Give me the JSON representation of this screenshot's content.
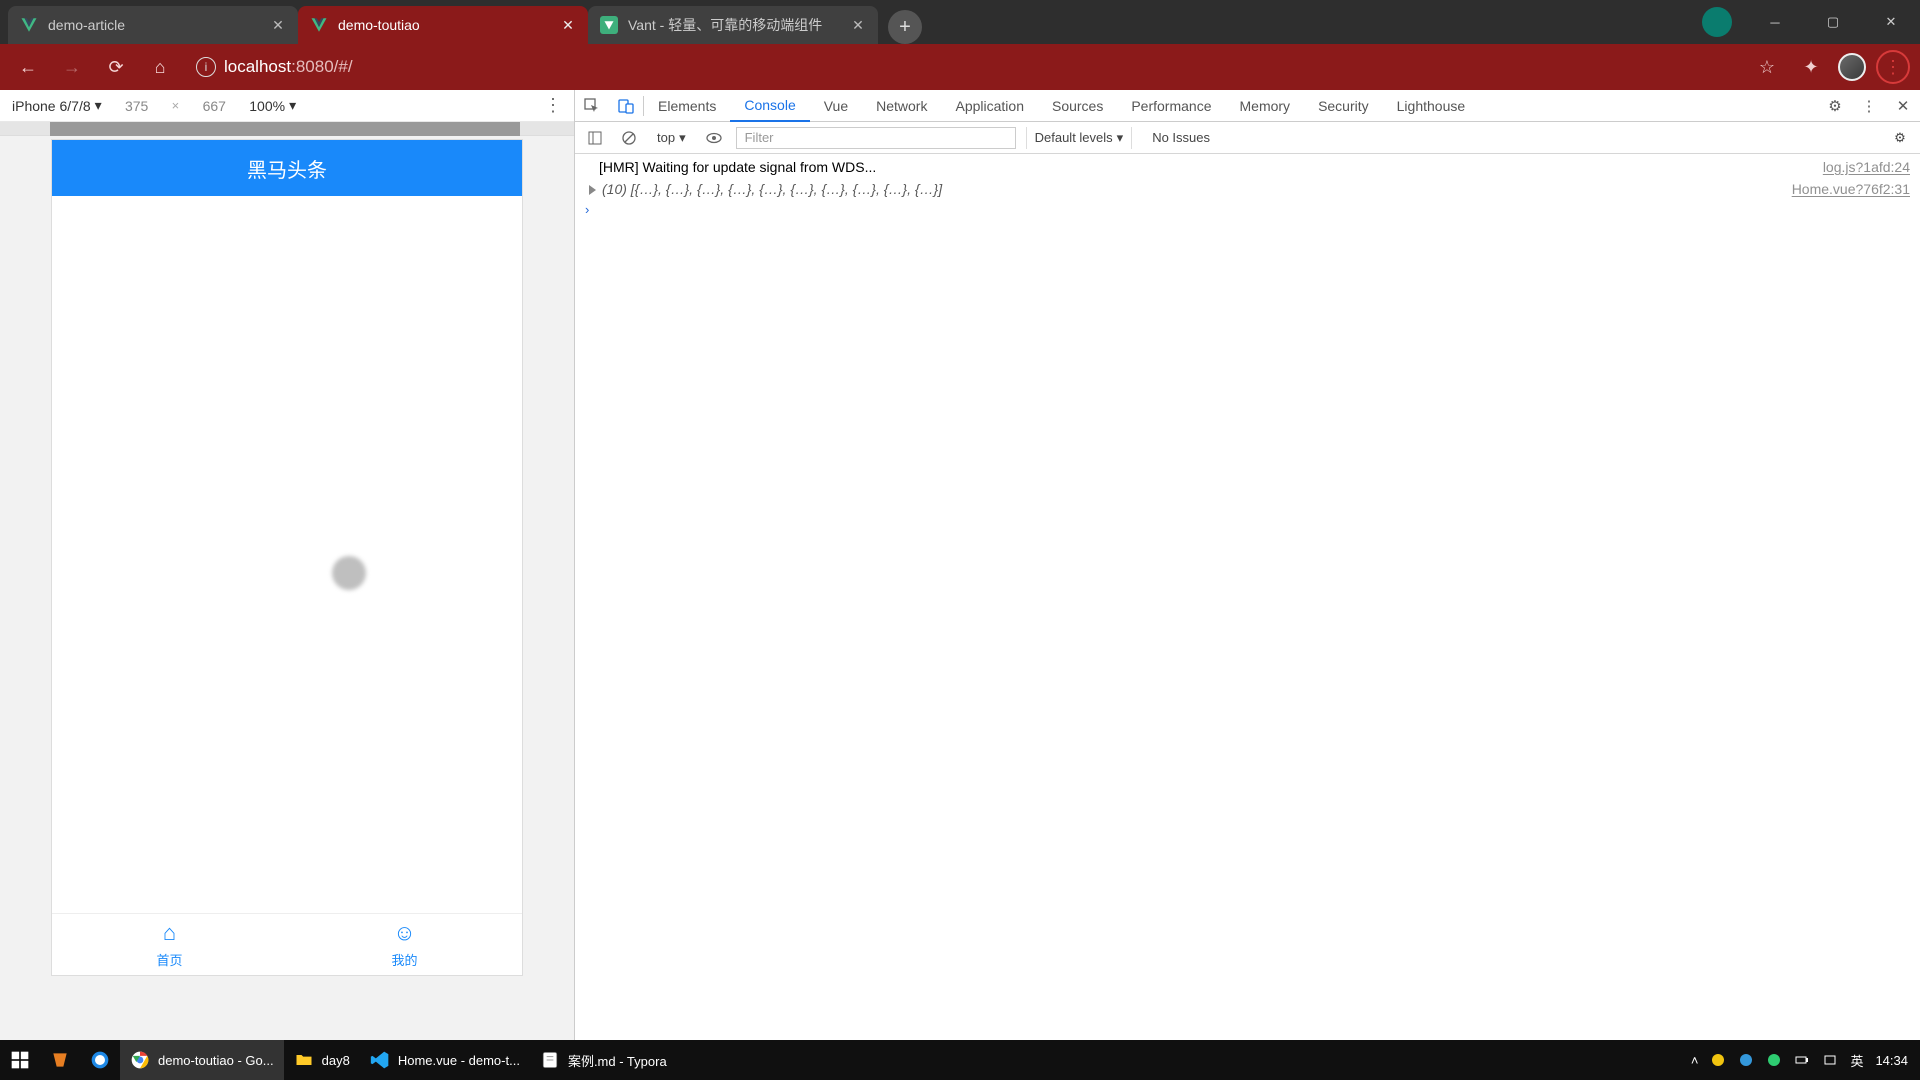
{
  "browser": {
    "tabs": [
      {
        "title": "demo-article",
        "active": false,
        "fav": "vue"
      },
      {
        "title": "demo-toutiao",
        "active": true,
        "fav": "vue"
      },
      {
        "title": "Vant - 轻量、可靠的移动端组件",
        "active": false,
        "fav": "vant"
      }
    ],
    "url_host": "localhost",
    "url_port_path": ":8080/#/"
  },
  "device_toolbar": {
    "device": "iPhone 6/7/8",
    "width": "375",
    "height": "667",
    "zoom": "100%"
  },
  "devtools": {
    "tabs": [
      "Elements",
      "Console",
      "Vue",
      "Network",
      "Application",
      "Sources",
      "Performance",
      "Memory",
      "Security",
      "Lighthouse"
    ],
    "active_tab": "Console",
    "context": "top",
    "filter_placeholder": "Filter",
    "levels": "Default levels",
    "issues": "No Issues",
    "logs": [
      {
        "msg": "[HMR] Waiting for update signal from WDS...",
        "src": "log.js?1afd:24",
        "expandable": false,
        "italic": false
      },
      {
        "msg": "(10) [{…}, {…}, {…}, {…}, {…}, {…}, {…}, {…}, {…}, {…}]",
        "src": "Home.vue?76f2:31",
        "expandable": true,
        "italic": true
      }
    ]
  },
  "phone": {
    "header_title": "黑马头条",
    "tabs": [
      {
        "label": "首页",
        "active": true
      },
      {
        "label": "我的",
        "active": false
      }
    ]
  },
  "taskbar": {
    "items": [
      {
        "label": "demo-toutiao - Go...",
        "active": true,
        "icon": "chrome"
      },
      {
        "label": "day8",
        "active": false,
        "icon": "folder"
      },
      {
        "label": "Home.vue - demo-t...",
        "active": false,
        "icon": "vscode"
      },
      {
        "label": "案例.md - Typora",
        "active": false,
        "icon": "typora"
      }
    ],
    "ime": "英",
    "time": "14:34"
  }
}
